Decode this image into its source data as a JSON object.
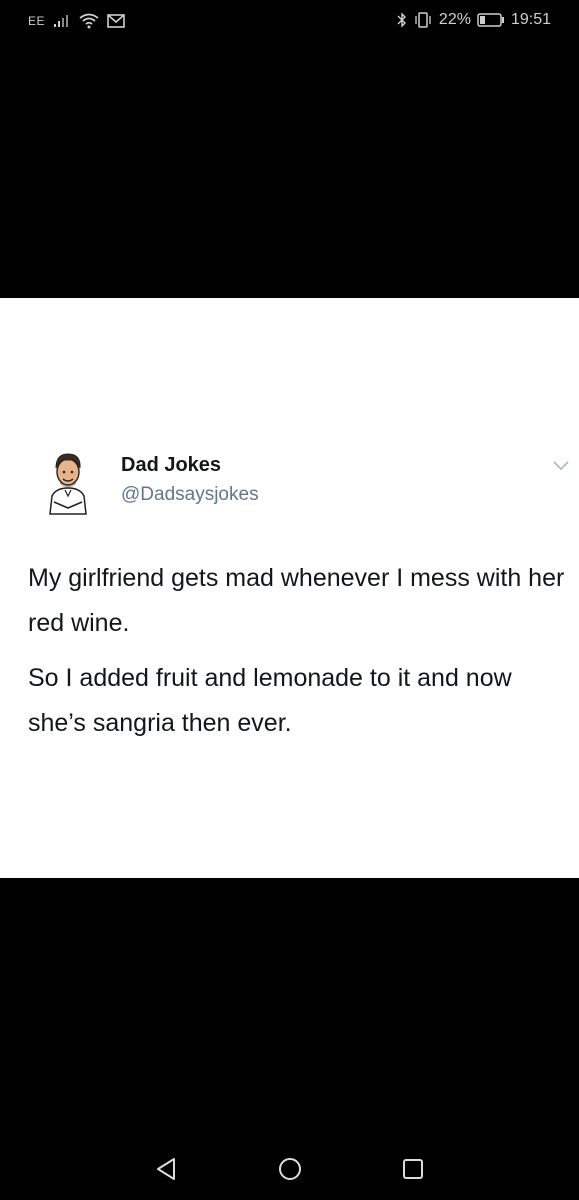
{
  "status_bar": {
    "carrier": "EE",
    "battery_percent": "22%",
    "time": "19:51",
    "icons": [
      "signal-icon",
      "wifi-icon",
      "mail-icon",
      "bluetooth-icon",
      "vibrate-icon",
      "battery-icon"
    ]
  },
  "tweet": {
    "author_name": "Dad Jokes",
    "author_handle": "@Dadsaysjokes",
    "paragraphs": [
      "My girlfriend gets mad whenever I mess with her red wine.",
      "So I added fruit and lemonade to it and now she’s sangria then ever."
    ]
  },
  "nav_bar": {
    "buttons": [
      "back-icon",
      "home-icon",
      "recents-icon"
    ]
  },
  "colors": {
    "background": "#000000",
    "card": "#ffffff",
    "text": "#14171a",
    "handle": "#657786"
  }
}
